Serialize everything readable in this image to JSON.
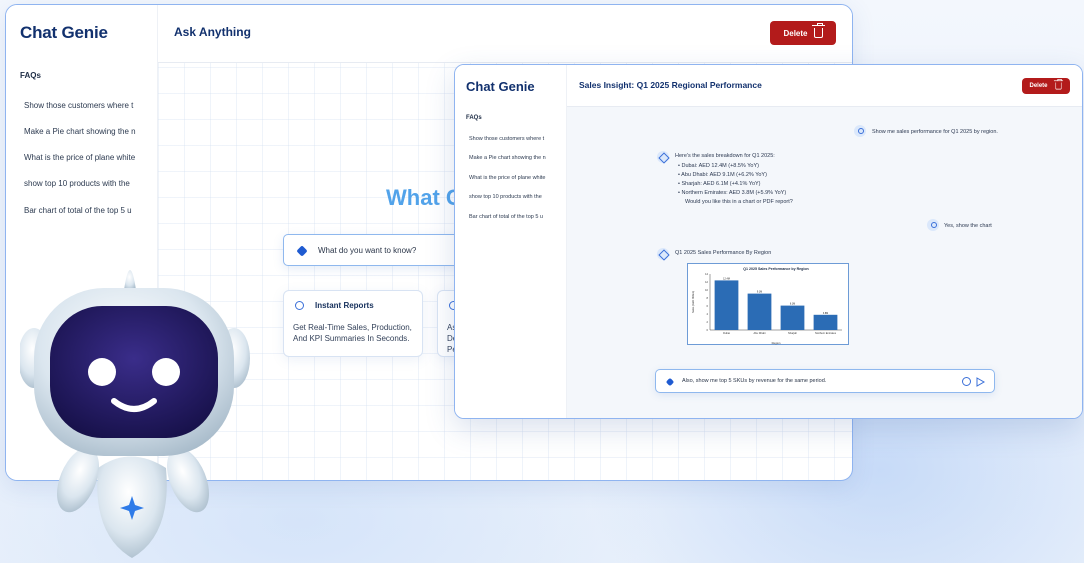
{
  "back_window": {
    "logo": "Chat Genie",
    "title": "Ask Anything",
    "delete_label": "Delete",
    "faq_title": "FAQs",
    "faqs": [
      "Show those customers where t",
      "Make a Pie chart showing the n",
      "What is the price of plane white",
      "show top 10 products with the",
      "Bar chart of total of the top 5 u"
    ],
    "hero": "What C",
    "search_placeholder": "What do you want to know?",
    "cards": [
      {
        "title": "Instant Reports",
        "body": "Get Real-Time Sales, Production, And KPI Summaries In Seconds."
      },
      {
        "title": "",
        "body": "Ask\nDe\nPer"
      }
    ]
  },
  "front_window": {
    "logo": "Chat Genie",
    "title": "Sales Insight: Q1 2025 Regional Performance",
    "delete_label": "Delete",
    "faq_title": "FAQs",
    "faqs": [
      "Show those customers where t",
      "Make a Pie chart showing the n",
      "What is the price of plane white",
      "show top 10 products with the",
      "Bar chart of total of the top 5 u"
    ],
    "messages": {
      "user_1": "Show me sales performance for Q1 2025 by region.",
      "bot_intro": "Here's the sales breakdown for Q1 2025:",
      "bot_bullets": [
        "Dubai: AED 12.4M (+8.5% YoY)",
        "Abu Dhabi: AED 9.1M (+6.2% YoY)",
        "Sharjah: AED 6.1M (+4.1% YoY)",
        "Northern Emirates: AED 3.8M (+5.9% YoY)"
      ],
      "bot_question": "Would you like this in a chart or PDF report?",
      "user_2": "Yes, show the chart",
      "bot_chart_caption": "Q1 2025 Sales Performance By Region"
    },
    "input_text": "Also, show me top 5 SKUs by revenue for the same period."
  },
  "chart_data": {
    "type": "bar",
    "title": "Q1 2025 Sales Performance by Region",
    "categories": [
      "Dubai",
      "Abu Dhabi",
      "Sharjah",
      "Northern Emirates"
    ],
    "values": [
      12.4,
      9.1,
      6.1,
      3.8
    ],
    "data_labels": [
      "12.4M",
      "9.1M",
      "6.1M",
      "3.8M"
    ],
    "xlabel": "Region",
    "ylabel": "Sales (AED Million)",
    "ylim": [
      0,
      14
    ],
    "yticks": [
      0,
      2,
      4,
      6,
      8,
      10,
      12,
      14
    ],
    "color": "#2b6cb5",
    "grid": false
  },
  "colors": {
    "brand_navy": "#12316e",
    "accent_blue": "#52a3ea",
    "delete_red": "#b31b1b",
    "robot_face": "#241a5e"
  }
}
